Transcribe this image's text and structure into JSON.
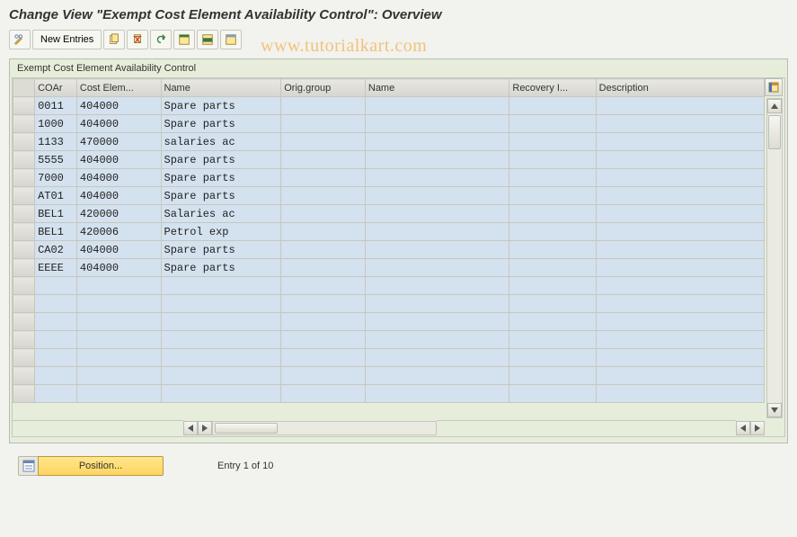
{
  "title": "Change View \"Exempt Cost Element Availability Control\": Overview",
  "watermark": "www.tutorialkart.com",
  "toolbar": {
    "new_entries_label": "New Entries"
  },
  "group": {
    "title": "Exempt Cost Element Availability Control"
  },
  "table": {
    "columns": {
      "coar": "COAr",
      "cost_elem": "Cost Elem...",
      "name": "Name",
      "orig_group": "Orig.group",
      "name2": "Name",
      "recovery": "Recovery I...",
      "description": "Description"
    },
    "rows": [
      {
        "coar": "0011",
        "cost_elem": "404000",
        "name": "Spare parts",
        "orig_group": "",
        "name2": "",
        "recovery": "",
        "description": ""
      },
      {
        "coar": "1000",
        "cost_elem": "404000",
        "name": "Spare parts",
        "orig_group": "",
        "name2": "",
        "recovery": "",
        "description": ""
      },
      {
        "coar": "1133",
        "cost_elem": "470000",
        "name": "salaries ac",
        "orig_group": "",
        "name2": "",
        "recovery": "",
        "description": ""
      },
      {
        "coar": "5555",
        "cost_elem": "404000",
        "name": "Spare parts",
        "orig_group": "",
        "name2": "",
        "recovery": "",
        "description": ""
      },
      {
        "coar": "7000",
        "cost_elem": "404000",
        "name": "Spare parts",
        "orig_group": "",
        "name2": "",
        "recovery": "",
        "description": ""
      },
      {
        "coar": "AT01",
        "cost_elem": "404000",
        "name": "Spare parts",
        "orig_group": "",
        "name2": "",
        "recovery": "",
        "description": ""
      },
      {
        "coar": "BEL1",
        "cost_elem": "420000",
        "name": "Salaries ac",
        "orig_group": "",
        "name2": "",
        "recovery": "",
        "description": ""
      },
      {
        "coar": "BEL1",
        "cost_elem": "420006",
        "name": "Petrol exp",
        "orig_group": "",
        "name2": "",
        "recovery": "",
        "description": ""
      },
      {
        "coar": "CA02",
        "cost_elem": "404000",
        "name": "Spare parts",
        "orig_group": "",
        "name2": "",
        "recovery": "",
        "description": ""
      },
      {
        "coar": "EEEE",
        "cost_elem": "404000",
        "name": "Spare parts",
        "orig_group": "",
        "name2": "",
        "recovery": "",
        "description": ""
      }
    ],
    "empty_row_count": 7
  },
  "footer": {
    "position_label": "Position...",
    "entry_info": "Entry 1 of 10"
  }
}
